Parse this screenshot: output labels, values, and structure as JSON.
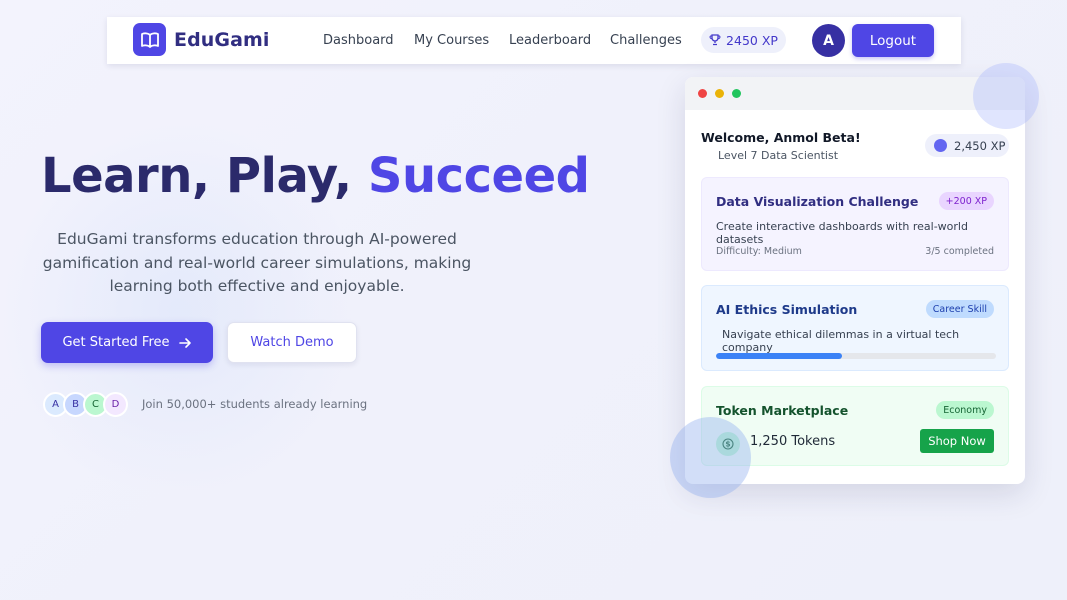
{
  "nav": {
    "brand": "EduGami",
    "links": [
      "Dashboard",
      "My Courses",
      "Leaderboard",
      "Challenges"
    ],
    "xp": "2450 XP",
    "avatar_initial": "A",
    "logout_label": "Logout"
  },
  "hero": {
    "title_part1": "Learn, Play, ",
    "title_accent": "Succeed",
    "description": "EduGami transforms education through AI-powered gamification and real-world career simulations, making learning both effective and enjoyable.",
    "primary_button": "Get Started Free",
    "secondary_button": "Watch Demo",
    "avatars": [
      "A",
      "B",
      "C",
      "D"
    ],
    "students_text": "Join 50,000+ students already learning"
  },
  "app_preview": {
    "welcome": "Welcome, Anmol Beta!",
    "level": "Level 7 Data Scientist",
    "xp": "2,450 XP",
    "tasks": [
      {
        "title": "Data Visualization Challenge",
        "tag": "+200 XP",
        "description": "Create interactive dashboards with real-world datasets",
        "difficulty": "Difficulty: Medium",
        "progress_text": "3/5 completed"
      },
      {
        "title": "AI Ethics Simulation",
        "tag": "Career Skill",
        "description": "Navigate ethical dilemmas in a virtual tech company",
        "progress": 0.45
      },
      {
        "title": "Token Marketplace",
        "tag": "Economy",
        "tokens": "1,250 Tokens",
        "shop_label": "Shop Now"
      }
    ]
  },
  "colors": {
    "primary": "#4f46e5",
    "title": "#2b2a6b",
    "progress": "#3b82f6",
    "shop": "#16a34a"
  }
}
